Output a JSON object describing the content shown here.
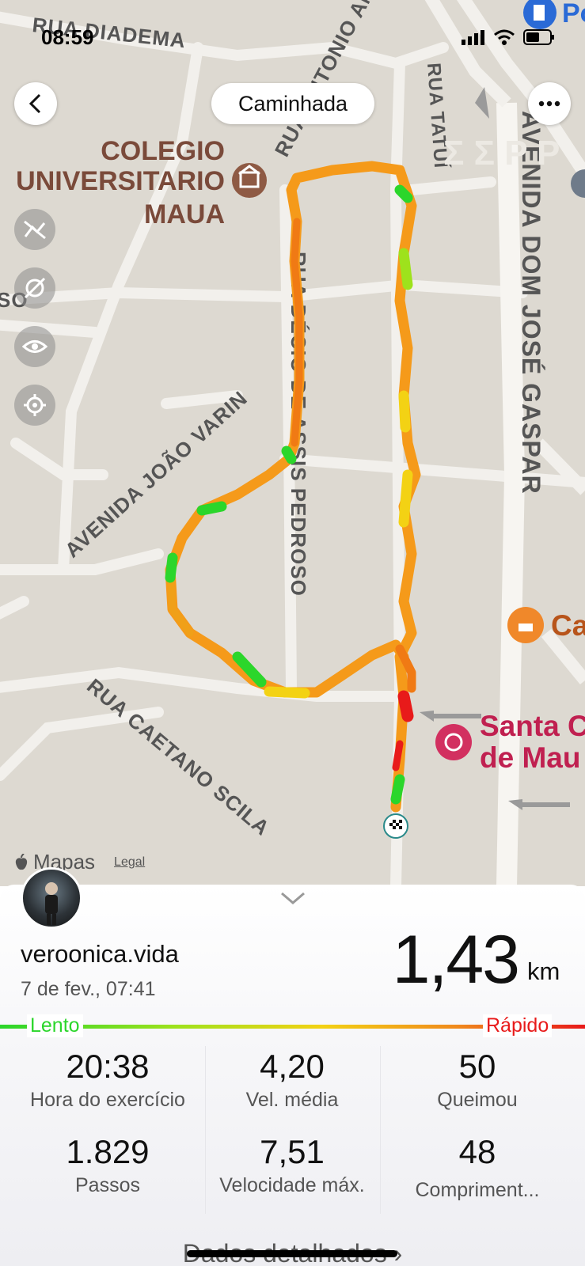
{
  "status_bar": {
    "time": "08:59"
  },
  "header": {
    "activity_title": "Caminhada"
  },
  "map": {
    "streets": {
      "diadema": "RUA DIADEMA",
      "antonio_andrade": "RUA ANTONIO ANDRADE",
      "tatui": "RUA TATUÍ",
      "dom_jose": "AVENIDA DOM JOSÉ GASPAR",
      "joao_varin": "AVENIDA JOÃO VARIN",
      "pedroso": "RUA DÉCIO DE ASSIS PEDROSO",
      "caetano": "RUA CAETANO SCILA",
      "partial_left": "SO",
      "partial_ru": "RU"
    },
    "pois": {
      "college": [
        "COLEGIO",
        "UNIVERSITARIO",
        "MAUA"
      ],
      "santa_line1": "Santa C",
      "santa_line2": "de Mau",
      "cake": "Ca",
      "gas": "Po",
      "watermark": "Σ Σ P P"
    },
    "attribution": "Mapas",
    "legal": "Legal"
  },
  "summary": {
    "username": "veroonica.vida",
    "date": "7 de fev., 07:41",
    "distance": "1,43",
    "distance_unit": "km",
    "speed_scale": {
      "slow": "Lento",
      "fast": "Rápido"
    },
    "stats": [
      {
        "value": "20:38",
        "label": "Hora do exercício"
      },
      {
        "value": "4,20",
        "label": "Vel. média"
      },
      {
        "value": "50",
        "label": "Queimou"
      },
      {
        "value": "1.829",
        "label": "Passos"
      },
      {
        "value": "7,51",
        "label": "Velocidade máx."
      },
      {
        "value": "48",
        "label": "Compriment..."
      }
    ],
    "details_link": "Dados detalhados"
  },
  "colors": {
    "slow": "#2bd62b",
    "fast": "#e81a1a",
    "route_mid": "#f5a014",
    "route_main": "#f59a1a"
  }
}
